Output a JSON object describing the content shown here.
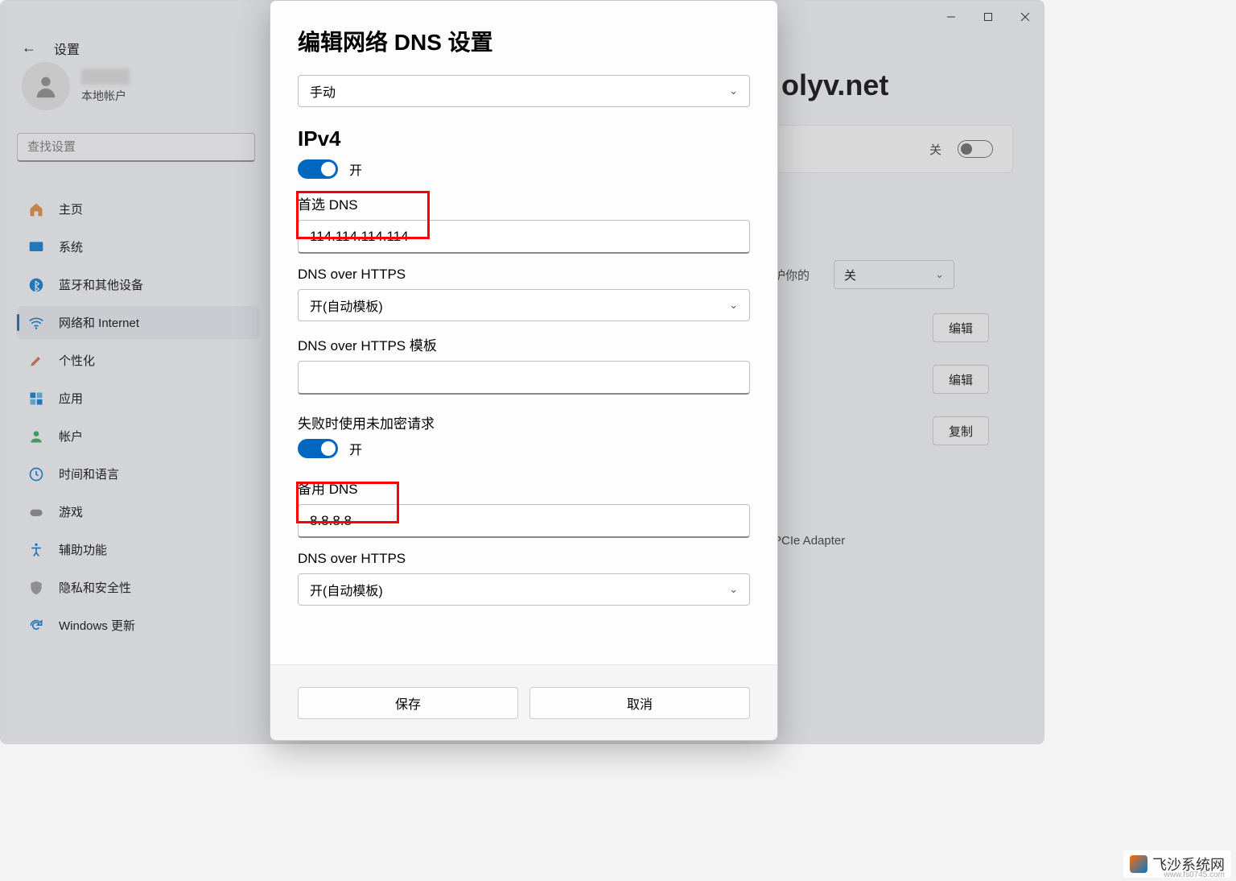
{
  "window": {
    "app_title": "设置",
    "user_sub": "本地帐户",
    "search_placeholder": "查找设置"
  },
  "nav": {
    "items": [
      {
        "label": "主页",
        "icon": "home"
      },
      {
        "label": "系统",
        "icon": "system"
      },
      {
        "label": "蓝牙和其他设备",
        "icon": "bluetooth"
      },
      {
        "label": "网络和 Internet",
        "icon": "wifi",
        "active": true
      },
      {
        "label": "个性化",
        "icon": "brush"
      },
      {
        "label": "应用",
        "icon": "apps"
      },
      {
        "label": "帐户",
        "icon": "account"
      },
      {
        "label": "时间和语言",
        "icon": "time"
      },
      {
        "label": "游戏",
        "icon": "game"
      },
      {
        "label": "辅助功能",
        "icon": "accessibility"
      },
      {
        "label": "隐私和安全性",
        "icon": "privacy"
      },
      {
        "label": "Windows 更新",
        "icon": "update"
      }
    ]
  },
  "content": {
    "title_partial": "olyv.net",
    "toggle_label": "关",
    "protect_text": "护你的",
    "select_off_label": "关",
    "edit_btn": "编辑",
    "copy_btn": "复制",
    "adapter_text": "PCIe Adapter"
  },
  "modal": {
    "title": "编辑网络 DNS 设置",
    "mode_select": "手动",
    "ipv4_heading": "IPv4",
    "ipv4_toggle": "开",
    "primary_dns_label": "首选 DNS",
    "primary_dns_value": "114.114.114.114",
    "doh_label": "DNS over HTTPS",
    "doh_value": "开(自动模板)",
    "doh_template_label": "DNS over HTTPS 模板",
    "doh_template_value": "",
    "fallback_label": "失败时使用未加密请求",
    "fallback_toggle": "开",
    "alt_dns_label": "备用 DNS",
    "alt_dns_value": "8.8.8.8",
    "doh2_label": "DNS over HTTPS",
    "doh2_value": "开(自动模板)",
    "save_btn": "保存",
    "cancel_btn": "取消"
  },
  "watermark": {
    "text": "飞沙系统网",
    "url": "www.fs0745.com"
  }
}
